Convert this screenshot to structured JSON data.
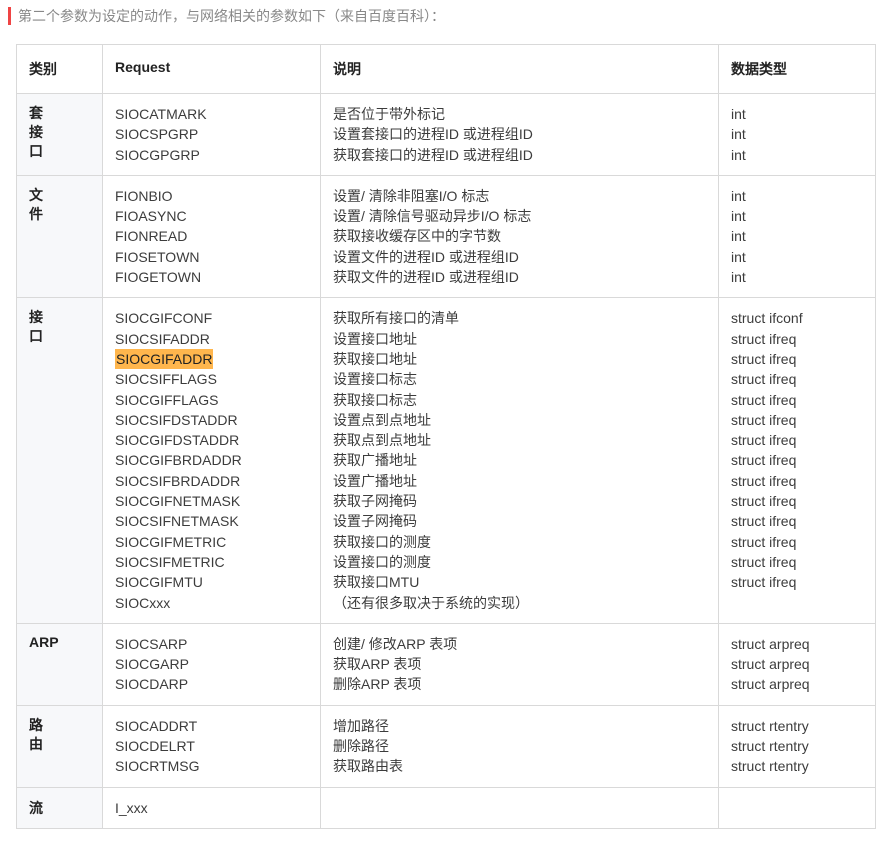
{
  "intro": "第二个参数为设定的动作，与网络相关的参数如下（来自百度百科）：",
  "headers": {
    "category": "类别",
    "request": "Request",
    "description": "说明",
    "datatype": "数据类型"
  },
  "highlighted_request": "SIOCGIFADDR",
  "groups": [
    {
      "category": "套接口",
      "rows": [
        {
          "request": "SIOCATMARK",
          "description": "是否位于带外标记",
          "datatype": "int"
        },
        {
          "request": "SIOCSPGRP",
          "description": "设置套接口的进程ID 或进程组ID",
          "datatype": "int"
        },
        {
          "request": "SIOCGPGRP",
          "description": "获取套接口的进程ID 或进程组ID",
          "datatype": "int"
        }
      ]
    },
    {
      "category": "文件",
      "rows": [
        {
          "request": "FIONBIO",
          "description": "设置/ 清除非阻塞I/O 标志",
          "datatype": "int"
        },
        {
          "request": "FIOASYNC",
          "description": "设置/ 清除信号驱动异步I/O 标志",
          "datatype": "int"
        },
        {
          "request": "FIONREAD",
          "description": "获取接收缓存区中的字节数",
          "datatype": "int"
        },
        {
          "request": "FIOSETOWN",
          "description": "设置文件的进程ID 或进程组ID",
          "datatype": "int"
        },
        {
          "request": "FIOGETOWN",
          "description": "获取文件的进程ID 或进程组ID",
          "datatype": "int"
        }
      ]
    },
    {
      "category": "接口",
      "rows": [
        {
          "request": "SIOCGIFCONF",
          "description": "获取所有接口的清单",
          "datatype": "struct ifconf"
        },
        {
          "request": "SIOCSIFADDR",
          "description": "设置接口地址",
          "datatype": "struct ifreq"
        },
        {
          "request": "SIOCGIFADDR",
          "description": "获取接口地址",
          "datatype": "struct ifreq"
        },
        {
          "request": "SIOCSIFFLAGS",
          "description": "设置接口标志",
          "datatype": "struct ifreq"
        },
        {
          "request": "SIOCGIFFLAGS",
          "description": "获取接口标志",
          "datatype": "struct ifreq"
        },
        {
          "request": "SIOCSIFDSTADDR",
          "description": "设置点到点地址",
          "datatype": "struct ifreq"
        },
        {
          "request": "SIOCGIFDSTADDR",
          "description": "获取点到点地址",
          "datatype": "struct ifreq"
        },
        {
          "request": "SIOCGIFBRDADDR",
          "description": "获取广播地址",
          "datatype": "struct ifreq"
        },
        {
          "request": "SIOCSIFBRDADDR",
          "description": "设置广播地址",
          "datatype": "struct ifreq"
        },
        {
          "request": "SIOCGIFNETMASK",
          "description": "获取子网掩码",
          "datatype": "struct ifreq"
        },
        {
          "request": "SIOCSIFNETMASK",
          "description": "设置子网掩码",
          "datatype": "struct ifreq"
        },
        {
          "request": "SIOCGIFMETRIC",
          "description": "获取接口的测度",
          "datatype": "struct ifreq"
        },
        {
          "request": "SIOCSIFMETRIC",
          "description": "设置接口的测度",
          "datatype": "struct ifreq"
        },
        {
          "request": "SIOCGIFMTU",
          "description": "获取接口MTU",
          "datatype": "struct ifreq"
        },
        {
          "request": "SIOCxxx",
          "description": "（还有很多取决于系统的实现）",
          "datatype": ""
        }
      ]
    },
    {
      "category": "ARP",
      "category_horizontal": true,
      "rows": [
        {
          "request": "SIOCSARP",
          "description": "创建/ 修改ARP 表项",
          "datatype": "struct arpreq"
        },
        {
          "request": "SIOCGARP",
          "description": "获取ARP 表项",
          "datatype": "struct arpreq"
        },
        {
          "request": "SIOCDARP",
          "description": "删除ARP 表项",
          "datatype": "struct arpreq"
        }
      ]
    },
    {
      "category": "路由",
      "rows": [
        {
          "request": "SIOCADDRT",
          "description": "增加路径",
          "datatype": "struct rtentry"
        },
        {
          "request": "SIOCDELRT",
          "description": "删除路径",
          "datatype": "struct rtentry"
        },
        {
          "request": "SIOCRTMSG",
          "description": "获取路由表",
          "datatype": "struct rtentry"
        }
      ]
    },
    {
      "category": "流",
      "category_horizontal": true,
      "rows": [
        {
          "request": "I_xxx",
          "description": "",
          "datatype": ""
        }
      ]
    }
  ]
}
